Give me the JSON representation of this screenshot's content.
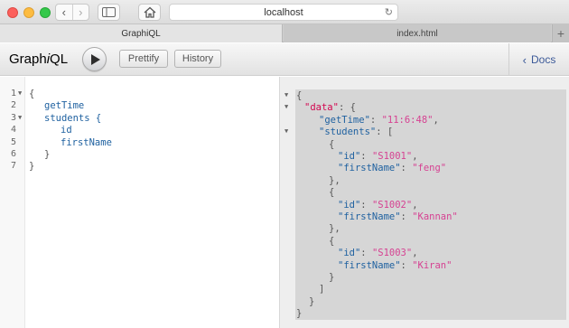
{
  "browser": {
    "url": "localhost",
    "tabs": [
      {
        "label": "GraphiQL"
      },
      {
        "label": "index.html"
      }
    ],
    "new_tab_symbol": "+"
  },
  "toolbar": {
    "logo_prefix": "Graph",
    "logo_italic": "i",
    "logo_suffix": "QL",
    "prettify_label": "Prettify",
    "history_label": "History",
    "docs_label": "Docs"
  },
  "query_editor": {
    "line_numbers": [
      "1",
      "2",
      "3",
      "4",
      "5",
      "6",
      "7"
    ],
    "lines": [
      "{",
      "getTime",
      "students {",
      "id",
      "firstName",
      "}",
      "}"
    ]
  },
  "result": {
    "lines": [
      "{",
      "\"data\": {",
      "\"getTime\": \"11:6:48\",",
      "\"students\": [",
      "{",
      "\"id\": \"S1001\",",
      "\"firstName\": \"feng\"",
      "},",
      "{",
      "\"id\": \"S1002\",",
      "\"firstName\": \"Kannan\"",
      "},",
      "{",
      "\"id\": \"S1003\",",
      "\"firstName\": \"Kiran\"",
      "}",
      "]",
      "}",
      "}"
    ]
  }
}
